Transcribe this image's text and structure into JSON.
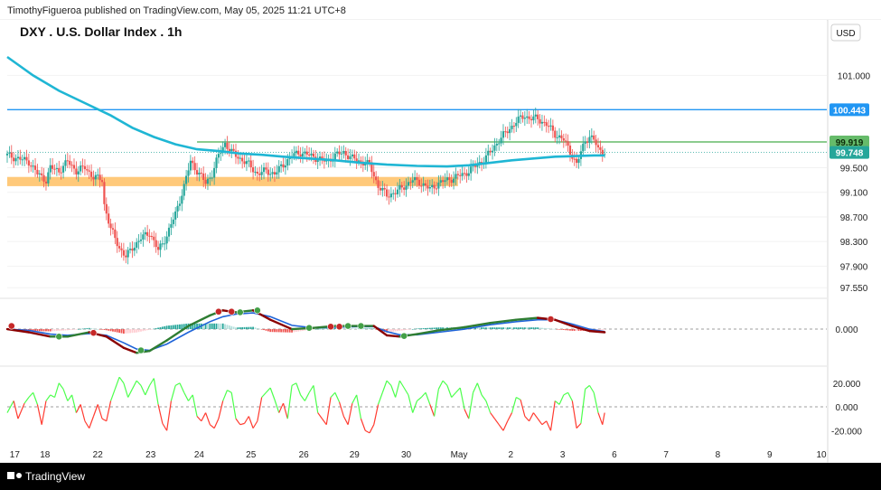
{
  "header": {
    "publish_line": "TimothyFigueroa published on TradingView.com, May 05, 2025 11:21 UTC+8",
    "title": "DXY . U.S. Dollar Index . 1h",
    "currency": "USD"
  },
  "footer": {
    "brand": "TradingView",
    "logo_icon": "tradingview-logo-icon"
  },
  "colors": {
    "up": "#26a69a",
    "down": "#ef5350",
    "ema": "#1fb6d4",
    "zone": "#ffb74d",
    "blue_line": "#2196f3",
    "green_line": "#66bb6a",
    "macd_fast": "#2e7d32",
    "macd_slow": "#1e63d8",
    "rsi_up": "#4cff4c",
    "rsi_down": "#ff3b30"
  },
  "chart_data": [
    {
      "type": "candlestick",
      "title": "DXY . U.S. Dollar Index . 1h",
      "y_ticks": [
        "101.000",
        "99.500",
        "99.100",
        "98.700",
        "98.300",
        "97.900",
        "97.550"
      ],
      "ylim": [
        97.45,
        101.55
      ],
      "x_ticks": [
        "17",
        "18",
        "22",
        "23",
        "24",
        "25",
        "26",
        "29",
        "30",
        "May",
        "2",
        "3",
        "6",
        "7",
        "8",
        "9",
        "10"
      ],
      "price_labels": [
        {
          "name": "resistance-line",
          "value": "100.443"
        },
        {
          "name": "green-level",
          "value": "99.919"
        },
        {
          "name": "last-price",
          "value": "99.748"
        }
      ],
      "levels": {
        "resistance": 100.443,
        "green_level": 99.919,
        "last_price": 99.748,
        "support_zone": [
          99.2,
          99.35
        ]
      },
      "price_path": [
        [
          0,
          99.7
        ],
        [
          10,
          99.6
        ],
        [
          14,
          99.4
        ],
        [
          18,
          99.3
        ],
        [
          20,
          99.5
        ],
        [
          24,
          99.45
        ],
        [
          28,
          99.6
        ],
        [
          32,
          99.45
        ],
        [
          36,
          99.5
        ],
        [
          40,
          99.35
        ],
        [
          44,
          99.3
        ],
        [
          45,
          98.9
        ],
        [
          48,
          98.5
        ],
        [
          52,
          98.2
        ],
        [
          55,
          98.05
        ],
        [
          58,
          98.2
        ],
        [
          62,
          98.35
        ],
        [
          66,
          98.45
        ],
        [
          70,
          98.15
        ],
        [
          74,
          98.4
        ],
        [
          78,
          98.75
        ],
        [
          82,
          99.2
        ],
        [
          85,
          99.6
        ],
        [
          88,
          99.45
        ],
        [
          92,
          99.25
        ],
        [
          95,
          99.4
        ],
        [
          98,
          99.7
        ],
        [
          101,
          99.9
        ],
        [
          104,
          99.75
        ],
        [
          108,
          99.65
        ],
        [
          112,
          99.55
        ],
        [
          116,
          99.4
        ],
        [
          120,
          99.45
        ],
        [
          124,
          99.4
        ],
        [
          128,
          99.55
        ],
        [
          132,
          99.7
        ],
        [
          136,
          99.75
        ],
        [
          140,
          99.7
        ],
        [
          144,
          99.65
        ],
        [
          148,
          99.6
        ],
        [
          152,
          99.7
        ],
        [
          156,
          99.75
        ],
        [
          160,
          99.65
        ],
        [
          164,
          99.6
        ],
        [
          168,
          99.55
        ],
        [
          172,
          99.2
        ],
        [
          176,
          99.05
        ],
        [
          180,
          99.1
        ],
        [
          184,
          99.2
        ],
        [
          188,
          99.3
        ],
        [
          192,
          99.25
        ],
        [
          196,
          99.15
        ],
        [
          200,
          99.25
        ],
        [
          204,
          99.3
        ],
        [
          208,
          99.35
        ],
        [
          212,
          99.4
        ],
        [
          216,
          99.5
        ],
        [
          220,
          99.6
        ],
        [
          224,
          99.75
        ],
        [
          228,
          99.95
        ],
        [
          232,
          100.1
        ],
        [
          236,
          100.25
        ],
        [
          240,
          100.35
        ],
        [
          242,
          100.3
        ],
        [
          246,
          100.3
        ],
        [
          250,
          100.2
        ],
        [
          254,
          100.05
        ],
        [
          258,
          99.95
        ],
        [
          262,
          99.7
        ],
        [
          264,
          99.55
        ],
        [
          266,
          99.75
        ],
        [
          268,
          99.95
        ],
        [
          270,
          100.0
        ],
        [
          272,
          99.95
        ],
        [
          274,
          99.8
        ],
        [
          276,
          99.78
        ],
        [
          277,
          99.748
        ]
      ],
      "ema_path": [
        [
          0,
          101.3
        ],
        [
          12,
          101.0
        ],
        [
          24,
          100.75
        ],
        [
          36,
          100.55
        ],
        [
          48,
          100.35
        ],
        [
          58,
          100.15
        ],
        [
          68,
          100.0
        ],
        [
          78,
          99.88
        ],
        [
          88,
          99.8
        ],
        [
          98,
          99.77
        ],
        [
          108,
          99.73
        ],
        [
          118,
          99.71
        ],
        [
          128,
          99.68
        ],
        [
          140,
          99.65
        ],
        [
          152,
          99.62
        ],
        [
          164,
          99.58
        ],
        [
          176,
          99.55
        ],
        [
          190,
          99.53
        ],
        [
          204,
          99.52
        ],
        [
          214,
          99.54
        ],
        [
          224,
          99.58
        ],
        [
          234,
          99.62
        ],
        [
          244,
          99.65
        ],
        [
          254,
          99.68
        ],
        [
          264,
          99.69
        ],
        [
          272,
          99.7
        ],
        [
          277,
          99.7
        ]
      ],
      "x_range": [
        0,
        380
      ]
    },
    {
      "type": "line",
      "title": "",
      "y_ticks": [
        "0.000"
      ],
      "ylim": [
        -0.55,
        0.45
      ],
      "fast": [
        [
          0,
          0.0
        ],
        [
          10,
          -0.05
        ],
        [
          20,
          -0.12
        ],
        [
          28,
          -0.12
        ],
        [
          38,
          -0.05
        ],
        [
          46,
          -0.12
        ],
        [
          54,
          -0.3
        ],
        [
          60,
          -0.38
        ],
        [
          66,
          -0.35
        ],
        [
          74,
          -0.18
        ],
        [
          84,
          0.05
        ],
        [
          94,
          0.22
        ],
        [
          100,
          0.3
        ],
        [
          106,
          0.27
        ],
        [
          114,
          0.3
        ],
        [
          122,
          0.15
        ],
        [
          132,
          0.0
        ],
        [
          142,
          0.02
        ],
        [
          152,
          0.05
        ],
        [
          162,
          0.05
        ],
        [
          170,
          0.05
        ],
        [
          176,
          -0.1
        ],
        [
          182,
          -0.12
        ],
        [
          190,
          -0.08
        ],
        [
          200,
          -0.02
        ],
        [
          212,
          0.03
        ],
        [
          224,
          0.1
        ],
        [
          236,
          0.15
        ],
        [
          246,
          0.18
        ],
        [
          254,
          0.15
        ],
        [
          262,
          0.05
        ],
        [
          270,
          -0.03
        ],
        [
          277,
          -0.05
        ]
      ],
      "slow": [
        [
          0,
          0.0
        ],
        [
          10,
          -0.02
        ],
        [
          20,
          -0.08
        ],
        [
          28,
          -0.1
        ],
        [
          38,
          -0.07
        ],
        [
          46,
          -0.1
        ],
        [
          54,
          -0.22
        ],
        [
          60,
          -0.32
        ],
        [
          66,
          -0.34
        ],
        [
          74,
          -0.24
        ],
        [
          84,
          -0.05
        ],
        [
          94,
          0.12
        ],
        [
          100,
          0.2
        ],
        [
          106,
          0.24
        ],
        [
          114,
          0.26
        ],
        [
          122,
          0.2
        ],
        [
          132,
          0.06
        ],
        [
          142,
          0.02
        ],
        [
          152,
          0.03
        ],
        [
          162,
          0.04
        ],
        [
          170,
          0.04
        ],
        [
          176,
          -0.04
        ],
        [
          182,
          -0.09
        ],
        [
          190,
          -0.09
        ],
        [
          200,
          -0.05
        ],
        [
          212,
          0.0
        ],
        [
          224,
          0.07
        ],
        [
          236,
          0.12
        ],
        [
          246,
          0.15
        ],
        [
          254,
          0.15
        ],
        [
          262,
          0.08
        ],
        [
          270,
          0.0
        ],
        [
          277,
          -0.04
        ]
      ],
      "cross_dots": [
        {
          "x": 2,
          "y": 0.05,
          "kind": "down"
        },
        {
          "x": 24,
          "y": -0.12,
          "kind": "up"
        },
        {
          "x": 40,
          "y": -0.06,
          "kind": "down"
        },
        {
          "x": 62,
          "y": -0.34,
          "kind": "up"
        },
        {
          "x": 98,
          "y": 0.28,
          "kind": "down"
        },
        {
          "x": 104,
          "y": 0.28,
          "kind": "down"
        },
        {
          "x": 108,
          "y": 0.27,
          "kind": "up"
        },
        {
          "x": 116,
          "y": 0.3,
          "kind": "up"
        },
        {
          "x": 140,
          "y": 0.02,
          "kind": "up"
        },
        {
          "x": 150,
          "y": 0.04,
          "kind": "down"
        },
        {
          "x": 154,
          "y": 0.04,
          "kind": "down"
        },
        {
          "x": 158,
          "y": 0.05,
          "kind": "up"
        },
        {
          "x": 164,
          "y": 0.05,
          "kind": "up"
        },
        {
          "x": 184,
          "y": -0.11,
          "kind": "up"
        },
        {
          "x": 252,
          "y": 0.16,
          "kind": "down"
        }
      ]
    },
    {
      "type": "line",
      "title": "",
      "y_ticks": [
        "20.000",
        "0.000",
        "-20.000"
      ],
      "ylim": [
        -32,
        32
      ],
      "values": [
        [
          0,
          -5
        ],
        [
          3,
          5
        ],
        [
          5,
          -10
        ],
        [
          8,
          3
        ],
        [
          10,
          8
        ],
        [
          12,
          12
        ],
        [
          14,
          2
        ],
        [
          16,
          -15
        ],
        [
          18,
          5
        ],
        [
          20,
          10
        ],
        [
          22,
          8
        ],
        [
          24,
          20
        ],
        [
          26,
          15
        ],
        [
          28,
          5
        ],
        [
          30,
          10
        ],
        [
          32,
          -5
        ],
        [
          34,
          2
        ],
        [
          36,
          -12
        ],
        [
          38,
          -18
        ],
        [
          40,
          -8
        ],
        [
          42,
          2
        ],
        [
          44,
          -10
        ],
        [
          46,
          -12
        ],
        [
          48,
          5
        ],
        [
          50,
          15
        ],
        [
          52,
          25
        ],
        [
          54,
          20
        ],
        [
          56,
          8
        ],
        [
          58,
          15
        ],
        [
          60,
          22
        ],
        [
          62,
          18
        ],
        [
          64,
          10
        ],
        [
          66,
          18
        ],
        [
          68,
          24
        ],
        [
          70,
          2
        ],
        [
          72,
          -14
        ],
        [
          74,
          -20
        ],
        [
          76,
          5
        ],
        [
          78,
          18
        ],
        [
          80,
          20
        ],
        [
          82,
          12
        ],
        [
          84,
          5
        ],
        [
          86,
          10
        ],
        [
          88,
          -8
        ],
        [
          90,
          -12
        ],
        [
          92,
          -5
        ],
        [
          94,
          -15
        ],
        [
          96,
          -18
        ],
        [
          98,
          -10
        ],
        [
          100,
          5
        ],
        [
          102,
          14
        ],
        [
          104,
          12
        ],
        [
          106,
          -10
        ],
        [
          108,
          -15
        ],
        [
          110,
          -14
        ],
        [
          112,
          -8
        ],
        [
          114,
          -18
        ],
        [
          116,
          -12
        ],
        [
          118,
          8
        ],
        [
          120,
          12
        ],
        [
          122,
          16
        ],
        [
          124,
          6
        ],
        [
          126,
          -5
        ],
        [
          128,
          3
        ],
        [
          130,
          -10
        ],
        [
          132,
          18
        ],
        [
          134,
          20
        ],
        [
          136,
          10
        ],
        [
          138,
          5
        ],
        [
          140,
          12
        ],
        [
          142,
          18
        ],
        [
          144,
          -5
        ],
        [
          146,
          -10
        ],
        [
          148,
          -15
        ],
        [
          150,
          8
        ],
        [
          152,
          12
        ],
        [
          154,
          4
        ],
        [
          156,
          -8
        ],
        [
          158,
          -15
        ],
        [
          160,
          3
        ],
        [
          162,
          10
        ],
        [
          164,
          -10
        ],
        [
          166,
          -20
        ],
        [
          168,
          -22
        ],
        [
          170,
          -15
        ],
        [
          172,
          2
        ],
        [
          174,
          12
        ],
        [
          176,
          22
        ],
        [
          178,
          18
        ],
        [
          180,
          8
        ],
        [
          182,
          22
        ],
        [
          184,
          16
        ],
        [
          186,
          10
        ],
        [
          188,
          -5
        ],
        [
          190,
          5
        ],
        [
          192,
          8
        ],
        [
          194,
          12
        ],
        [
          196,
          2
        ],
        [
          198,
          -8
        ],
        [
          200,
          15
        ],
        [
          202,
          22
        ],
        [
          204,
          18
        ],
        [
          206,
          8
        ],
        [
          208,
          12
        ],
        [
          210,
          16
        ],
        [
          212,
          -2
        ],
        [
          214,
          -10
        ],
        [
          216,
          12
        ],
        [
          218,
          20
        ],
        [
          220,
          10
        ],
        [
          222,
          5
        ],
        [
          224,
          -5
        ],
        [
          226,
          -10
        ],
        [
          228,
          -15
        ],
        [
          230,
          -20
        ],
        [
          232,
          -12
        ],
        [
          234,
          -5
        ],
        [
          236,
          8
        ],
        [
          238,
          6
        ],
        [
          240,
          -8
        ],
        [
          242,
          -12
        ],
        [
          244,
          -5
        ],
        [
          246,
          -10
        ],
        [
          248,
          -15
        ],
        [
          250,
          -12
        ],
        [
          252,
          -20
        ],
        [
          254,
          5
        ],
        [
          256,
          2
        ],
        [
          258,
          10
        ],
        [
          260,
          12
        ],
        [
          262,
          5
        ],
        [
          264,
          -18
        ],
        [
          266,
          -14
        ],
        [
          268,
          15
        ],
        [
          270,
          18
        ],
        [
          272,
          12
        ],
        [
          274,
          -5
        ],
        [
          276,
          -15
        ],
        [
          277,
          -5
        ]
      ]
    }
  ]
}
